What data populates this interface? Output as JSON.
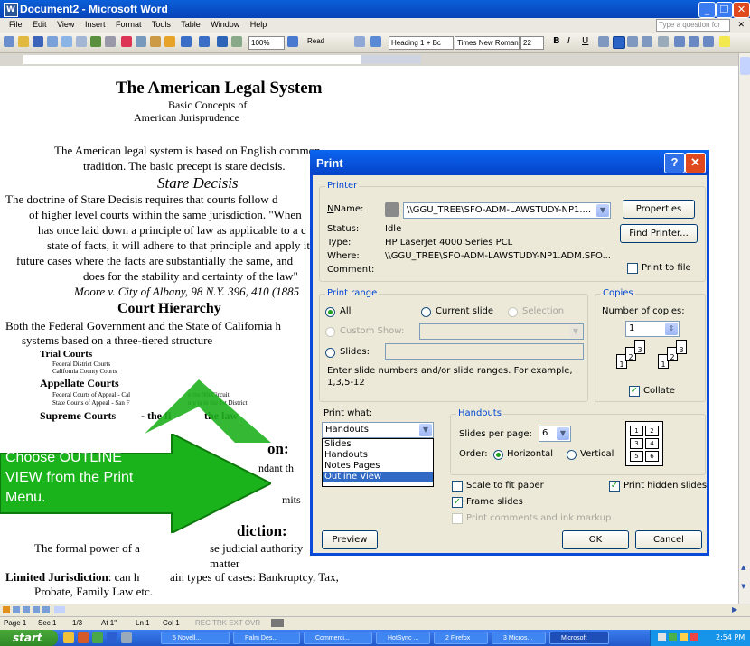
{
  "window": {
    "title": "Document2 - Microsoft Word",
    "help_placeholder": "Type a question for help"
  },
  "menubar": [
    "File",
    "Edit",
    "View",
    "Insert",
    "Format",
    "Tools",
    "Table",
    "Window",
    "Help"
  ],
  "toolbar": {
    "zoom": "100%",
    "read": "Read",
    "style": "Heading 1 + Bc",
    "font": "Times New Roman",
    "size": "22"
  },
  "document": {
    "title": "The American Legal System",
    "subtitle1": "Basic Concepts of",
    "subtitle2": "American Jurisprudence",
    "intro1": "The American legal system is based on English common",
    "intro2": "tradition.  The basic precept is stare decisis.",
    "heading_stare": "Stare Decisis",
    "sd1": "The doctrine of  Stare Decisis requires that courts follow d",
    "sd2": "of higher level courts within the same jurisdiction. \"When",
    "sd3": "has once laid down a principle of law as applicable to a c",
    "sd4": "state of facts, it will adhere to that principle and apply it",
    "sd5": "future cases where the facts are substantially the same, and",
    "sd6": "does for the stability and certainty of the law\"",
    "sd7": "Moore v. City of Albany, 98 N.Y. 396, 410 (1885",
    "heading_court": "Court Hierarchy",
    "ch1": "Both the Federal Government and the State of California h",
    "ch2": "systems based on a three-tiered structure",
    "trial": "Trial Courts",
    "trial_a": "Federal District Courts",
    "trial_b": "California County Courts",
    "appellate": "Appellate Courts",
    "app_a": "Federal Courts of Appeal - Cal",
    "app_a2": "n the 9th Circuit",
    "app_b": "State Courts of Appeal - San F",
    "app_b2": "nty is in the 1st District",
    "supreme": "Supreme Courts",
    "supreme_rest": "- the fi",
    "supreme_end": "the law",
    "frag_on": "on:",
    "frag_ndant": "ndant th",
    "frag_mits": "mits",
    "frag_diction": "diction:",
    "formal": "The formal power of a",
    "formal2": "se judicial authority",
    "matter": "matter",
    "limited_bold": "Limited Jurisdiction",
    "limited_rest": ": can h",
    "limited_rest2": "ain types of cases: Bankruptcy, Tax,",
    "limited_line2": "Probate, Family Law etc."
  },
  "callout": {
    "line1": "Choose OUTLINE",
    "line2": "VIEW from the Print",
    "line3": "Menu.",
    "color": "#1bb31b"
  },
  "dialog": {
    "title": "Print",
    "printer_group": "Printer",
    "name_label": "Name:",
    "name_value": "\\\\GGU_TREE\\SFO-ADM-LAWSTUDY-NP1....",
    "properties": "Properties",
    "status_label": "Status:",
    "status_value": "Idle",
    "type_label": "Type:",
    "type_value": "HP LaserJet 4000 Series PCL",
    "where_label": "Where:",
    "where_value": "\\\\GGU_TREE\\SFO-ADM-LAWSTUDY-NP1.ADM.SFO...",
    "comment_label": "Comment:",
    "find_printer": "Find Printer...",
    "print_to_file": "Print to file",
    "range_group": "Print range",
    "all": "All",
    "current_slide": "Current slide",
    "selection": "Selection",
    "custom_show": "Custom Show:",
    "slides": "Slides:",
    "hint": "Enter slide numbers and/or slide ranges. For example,",
    "hint2": "1,3,5-12",
    "copies_group": "Copies",
    "num_copies": "Number of copies:",
    "copies_value": "1",
    "collate": "Collate",
    "print_what": "Print what:",
    "print_what_value": "Handouts",
    "options": [
      "Slides",
      "Handouts",
      "Notes Pages",
      "Outline View"
    ],
    "handouts_group": "Handouts",
    "slides_per_page": "Slides per page:",
    "spp_value": "6",
    "order": "Order:",
    "horizontal": "Horizontal",
    "vertical": "Vertical",
    "handout_nums": [
      "1",
      "2",
      "3",
      "4",
      "5",
      "6"
    ],
    "scale": "Scale to fit paper",
    "frame": "Frame slides",
    "comments": "Print comments and ink markup",
    "hidden": "Print hidden slides",
    "preview": "Preview",
    "ok": "OK",
    "cancel": "Cancel"
  },
  "statusbar": {
    "page": "Page 1",
    "sec": "Sec 1",
    "pages": "1/3",
    "at": "At 1\"",
    "ln": "Ln 1",
    "col": "Col 1",
    "modes": "REC  TRK  EXT  OVR"
  },
  "taskbar": {
    "start": "start",
    "tasks": [
      "5 Novell...",
      "Palm Des...",
      "Commerci...",
      "HotSync ...",
      "2 Firefox",
      "3 Micros...",
      "Microsoft"
    ],
    "clock": "2:54 PM"
  }
}
